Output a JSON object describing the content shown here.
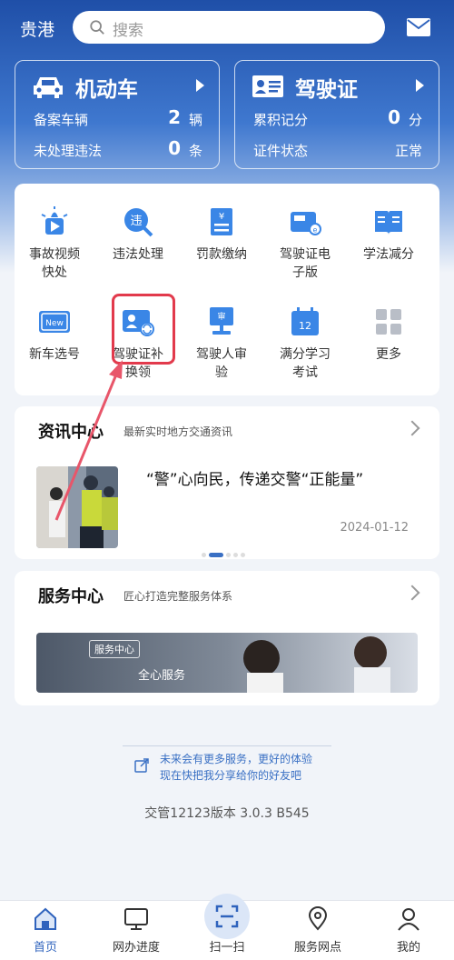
{
  "header": {
    "city": "贵港",
    "search_placeholder": "搜索"
  },
  "vehicle_card": {
    "title": "机动车",
    "rows": [
      {
        "label": "备案车辆",
        "value": "2",
        "unit": "辆"
      },
      {
        "label": "未处理违法",
        "value": "0",
        "unit": "条"
      }
    ]
  },
  "license_card": {
    "title": "驾驶证",
    "rows": [
      {
        "label": "累积记分",
        "value": "0",
        "unit": "分"
      },
      {
        "label": "证件状态",
        "status": "正常"
      }
    ]
  },
  "services": [
    {
      "label": "事故视频快处",
      "icon": "video-camera-icon"
    },
    {
      "label": "违法处理",
      "icon": "violation-search-icon"
    },
    {
      "label": "罚款缴纳",
      "icon": "fine-payment-icon"
    },
    {
      "label": "驾驶证电子版",
      "icon": "e-license-icon"
    },
    {
      "label": "学法减分",
      "icon": "book-icon"
    },
    {
      "label": "新车选号",
      "icon": "new-plate-icon"
    },
    {
      "label": "驾驶证补换领",
      "icon": "license-renew-icon"
    },
    {
      "label": "驾驶人审验",
      "icon": "driver-review-icon"
    },
    {
      "label": "满分学习考试",
      "icon": "exam-calendar-icon"
    },
    {
      "label": "更多",
      "icon": "more-grid-icon"
    }
  ],
  "news": {
    "title": "资讯中心",
    "subtitle": "最新实时地方交通资讯",
    "headline": "“警”心向民，传递交警“正能量”",
    "date": "2024-01-12"
  },
  "service_center": {
    "title": "服务中心",
    "subtitle": "匠心打造完整服务体系",
    "banner_tag": "服务中心",
    "banner_text": "全心服务"
  },
  "share": {
    "line1": "未来会有更多服务，更好的体验",
    "line2": "现在快把我分享给你的好友吧"
  },
  "version": "交管12123版本 3.0.3 B545",
  "bottom_nav": [
    {
      "label": "首页",
      "icon": "home-icon",
      "active": true
    },
    {
      "label": "网办进度",
      "icon": "monitor-icon"
    },
    {
      "label": "扫一扫",
      "icon": "scan-icon"
    },
    {
      "label": "服务网点",
      "icon": "location-pin-icon"
    },
    {
      "label": "我的",
      "icon": "user-icon"
    }
  ],
  "colors": {
    "brand_blue": "#2f63bd",
    "highlight_red": "#e23a4c",
    "link_blue": "#3a70c4"
  }
}
